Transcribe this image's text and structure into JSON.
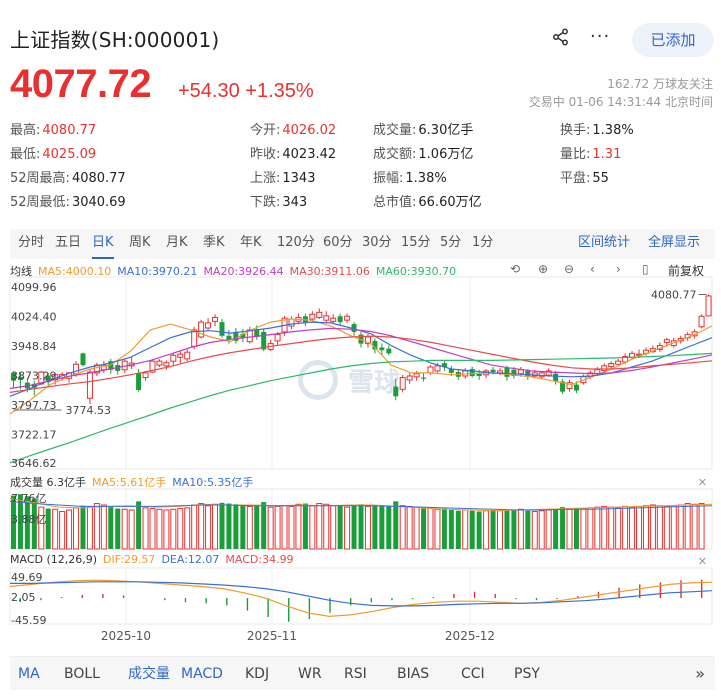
{
  "header": {
    "title": "上证指数(SH:000001)",
    "added_label": "已添加",
    "price": "4077.72",
    "change": "+54.30",
    "change_pct": "+1.35%",
    "followers": "162.72 万球友关注",
    "trade_time": "交易中 01-06 14:31:44 北京时间"
  },
  "stats": [
    {
      "label": "最高:",
      "value": "4080.77",
      "red": true
    },
    {
      "label": "今开:",
      "value": "4026.02",
      "red": true
    },
    {
      "label": "成交量:",
      "value": "6.30亿手",
      "red": false
    },
    {
      "label": "换手:",
      "value": "1.38%",
      "red": false
    },
    {
      "label": "最低:",
      "value": "4025.09",
      "red": true
    },
    {
      "label": "昨收:",
      "value": "4023.42",
      "red": false
    },
    {
      "label": "成交额:",
      "value": "1.06万亿",
      "red": false
    },
    {
      "label": "量比:",
      "value": "1.31",
      "red": true
    },
    {
      "label": "52周最高:",
      "value": "4080.77",
      "red": false
    },
    {
      "label": "上涨:",
      "value": "1343",
      "red": false
    },
    {
      "label": "振幅:",
      "value": "1.38%",
      "red": false
    },
    {
      "label": "平盘:",
      "value": "55",
      "red": false
    },
    {
      "label": "52周最低:",
      "value": "3040.69",
      "red": false
    },
    {
      "label": "下跌:",
      "value": "343",
      "red": false
    },
    {
      "label": "总市值:",
      "value": "66.60万亿",
      "red": false
    }
  ],
  "period_tabs": [
    "分时",
    "五日",
    "日K",
    "周K",
    "月K",
    "季K",
    "年K",
    "120分",
    "60分",
    "30分",
    "15分",
    "5分",
    "1分"
  ],
  "active_period": "日K",
  "tab_actions": {
    "range_stats": "区间统计",
    "fullscreen": "全屏显示"
  },
  "ma_legend": {
    "label": "均线",
    "items": [
      {
        "text": "MA5:4000.10",
        "color": "#f29a2e"
      },
      {
        "text": "MA10:3970.21",
        "color": "#3b6fd6"
      },
      {
        "text": "MA20:3926.44",
        "color": "#c23cc2"
      },
      {
        "text": "MA30:3911.06",
        "color": "#e84b4b"
      },
      {
        "text": "MA60:3930.70",
        "color": "#2fb86a"
      }
    ]
  },
  "adjust_label": "前复权",
  "vol_legend": {
    "label": "成交量 6.3亿手",
    "items": [
      {
        "text": "MA5:5.61亿手",
        "color": "#f29a2e"
      },
      {
        "text": "MA10:5.35亿手",
        "color": "#3b6fd6"
      }
    ]
  },
  "macd_legend": {
    "label": "MACD (12,26,9)",
    "items": [
      {
        "text": "DIF:29.57",
        "color": "#f29a2e"
      },
      {
        "text": "DEA:12.07",
        "color": "#3b6fd6"
      },
      {
        "text": "MACD:34.99",
        "color": "#e84b4b"
      }
    ]
  },
  "indicator_tabs": [
    "MA",
    "BOLL",
    "成交量",
    "MACD",
    "KDJ",
    "WR",
    "RSI",
    "BIAS",
    "CCI",
    "PSY"
  ],
  "active_indicators": [
    "MA",
    "成交量",
    "MACD"
  ],
  "colors": {
    "up": "#e93030",
    "down": "#1a9e3a",
    "accent": "#2f66c9"
  },
  "chart_data": {
    "type": "candlestick",
    "price_axis_labels": [
      "4099.96",
      "4024.40",
      "3948.84",
      "3873.29",
      "3797.73",
      "3722.17",
      "3646.62"
    ],
    "price_ylim": [
      3646.62,
      4099.96
    ],
    "high_marker": "4080.77",
    "low_marker": "3774.53",
    "x_labels": [
      "2025-10",
      "2025-11",
      "2025-12"
    ],
    "vol_axis_labels": [
      "7.76亿",
      "3.88亿"
    ],
    "vol_ylim": [
      0,
      7.76
    ],
    "macd_axis_labels": [
      "49.69",
      "2.05",
      "-45.59"
    ],
    "macd_ylim": [
      -45.59,
      49.69
    ],
    "candles": [
      [
        3880,
        3860,
        3883,
        3840,
        "d"
      ],
      [
        3870,
        3862,
        3880,
        3838,
        "d"
      ],
      [
        3855,
        3840,
        3866,
        3830,
        "d"
      ],
      [
        3852,
        3842,
        3860,
        3822,
        "d"
      ],
      [
        3852,
        3882,
        3885,
        3848,
        "u"
      ],
      [
        3873,
        3856,
        3880,
        3848,
        "d"
      ],
      [
        3862,
        3876,
        3880,
        3850,
        "u"
      ],
      [
        3866,
        3876,
        3882,
        3860,
        "u"
      ],
      [
        3866,
        3880,
        3882,
        3855,
        "u"
      ],
      [
        3878,
        3902,
        3910,
        3870,
        "u"
      ],
      [
        3930,
        3900,
        3932,
        3896,
        "d"
      ],
      [
        3815,
        3882,
        3890,
        3800,
        "u"
      ],
      [
        3880,
        3900,
        3906,
        3872,
        "u"
      ],
      [
        3888,
        3900,
        3910,
        3880,
        "u"
      ],
      [
        3910,
        3888,
        3916,
        3878,
        "d"
      ],
      [
        3900,
        3885,
        3912,
        3876,
        "d"
      ],
      [
        3888,
        3910,
        3916,
        3880,
        "u"
      ],
      [
        3898,
        3905,
        3922,
        3890,
        "u"
      ],
      [
        3880,
        3836,
        3890,
        3832,
        "d"
      ],
      [
        3868,
        3880,
        3885,
        3860,
        "u"
      ],
      [
        3882,
        3910,
        3912,
        3880,
        "u"
      ],
      [
        3900,
        3910,
        3915,
        3895,
        "u"
      ],
      [
        3898,
        3906,
        3912,
        3888,
        "u"
      ],
      [
        3910,
        3925,
        3930,
        3898,
        "u"
      ],
      [
        3920,
        3928,
        3935,
        3905,
        "u"
      ],
      [
        3916,
        3933,
        3940,
        3910,
        "u"
      ],
      [
        3948,
        3990,
        3998,
        3940,
        "u"
      ],
      [
        3972,
        4010,
        4016,
        3968,
        "u"
      ],
      [
        3995,
        4008,
        4020,
        3988,
        "u"
      ],
      [
        4012,
        4022,
        4030,
        4000,
        "u"
      ],
      [
        4010,
        3975,
        4018,
        3970,
        "d"
      ],
      [
        3975,
        3965,
        3990,
        3955,
        "d"
      ],
      [
        3985,
        3962,
        3995,
        3955,
        "d"
      ],
      [
        3980,
        3970,
        3992,
        3958,
        "d"
      ],
      [
        3960,
        3990,
        3998,
        3955,
        "u"
      ],
      [
        3992,
        3972,
        4002,
        3965,
        "d"
      ],
      [
        3985,
        3940,
        3992,
        3936,
        "d"
      ],
      [
        3940,
        3955,
        3965,
        3936,
        "u"
      ],
      [
        3962,
        3978,
        3985,
        3950,
        "u"
      ],
      [
        3985,
        4020,
        4026,
        3975,
        "u"
      ],
      [
        4000,
        4018,
        4025,
        3992,
        "u"
      ],
      [
        4012,
        4022,
        4032,
        4005,
        "u"
      ],
      [
        4025,
        4008,
        4032,
        4000,
        "d"
      ],
      [
        4018,
        4030,
        4038,
        4010,
        "u"
      ],
      [
        4022,
        4035,
        4045,
        4018,
        "u"
      ],
      [
        4015,
        4026,
        4038,
        4010,
        "u"
      ],
      [
        4012,
        4020,
        4030,
        4005,
        "u"
      ],
      [
        4025,
        4010,
        4032,
        4002,
        "d"
      ],
      [
        4015,
        4025,
        4032,
        4008,
        "u"
      ],
      [
        4005,
        3985,
        4010,
        3975,
        "d"
      ],
      [
        3978,
        3955,
        3985,
        3945,
        "d"
      ],
      [
        3955,
        3972,
        3980,
        3945,
        "u"
      ],
      [
        3962,
        3940,
        3968,
        3930,
        "d"
      ],
      [
        3945,
        3938,
        3955,
        3925,
        "d"
      ],
      [
        3942,
        3930,
        3950,
        3925,
        "d"
      ],
      [
        3845,
        3820,
        3865,
        3810,
        "d"
      ],
      [
        3838,
        3868,
        3875,
        3830,
        "u"
      ],
      [
        3862,
        3872,
        3880,
        3852,
        "u"
      ],
      [
        3870,
        3878,
        3885,
        3860,
        "u"
      ],
      [
        3868,
        3865,
        3880,
        3858,
        "d"
      ],
      [
        3880,
        3895,
        3900,
        3875,
        "u"
      ],
      [
        3885,
        3898,
        3905,
        3880,
        "u"
      ],
      [
        3905,
        3895,
        3912,
        3885,
        "d"
      ],
      [
        3890,
        3880,
        3898,
        3872,
        "d"
      ],
      [
        3882,
        3870,
        3890,
        3862,
        "d"
      ],
      [
        3872,
        3885,
        3892,
        3865,
        "u"
      ],
      [
        3890,
        3872,
        3896,
        3868,
        "d"
      ],
      [
        3878,
        3872,
        3888,
        3862,
        "d"
      ],
      [
        3875,
        3885,
        3890,
        3866,
        "u"
      ],
      [
        3888,
        3882,
        3895,
        3876,
        "d"
      ],
      [
        3880,
        3885,
        3892,
        3874,
        "u"
      ],
      [
        3893,
        3870,
        3898,
        3860,
        "d"
      ],
      [
        3888,
        3872,
        3895,
        3865,
        "d"
      ],
      [
        3878,
        3888,
        3895,
        3870,
        "u"
      ],
      [
        3885,
        3870,
        3890,
        3862,
        "d"
      ],
      [
        3872,
        3880,
        3888,
        3866,
        "u"
      ],
      [
        3870,
        3880,
        3885,
        3866,
        "u"
      ],
      [
        3874,
        3885,
        3892,
        3870,
        "u"
      ],
      [
        3878,
        3858,
        3885,
        3850,
        "d"
      ],
      [
        3858,
        3832,
        3865,
        3826,
        "d"
      ],
      [
        3840,
        3855,
        3862,
        3832,
        "u"
      ],
      [
        3850,
        3835,
        3858,
        3828,
        "d"
      ],
      [
        3855,
        3870,
        3876,
        3850,
        "u"
      ],
      [
        3870,
        3880,
        3886,
        3864,
        "u"
      ],
      [
        3878,
        3888,
        3895,
        3872,
        "u"
      ],
      [
        3886,
        3898,
        3904,
        3880,
        "u"
      ],
      [
        3896,
        3904,
        3910,
        3890,
        "u"
      ],
      [
        3902,
        3910,
        3916,
        3898,
        "u"
      ],
      [
        3908,
        3922,
        3930,
        3902,
        "u"
      ],
      [
        3920,
        3930,
        3936,
        3914,
        "u"
      ],
      [
        3925,
        3928,
        3940,
        3918,
        "u"
      ],
      [
        3930,
        3938,
        3945,
        3924,
        "u"
      ],
      [
        3935,
        3942,
        3950,
        3930,
        "u"
      ],
      [
        3940,
        3950,
        3958,
        3934,
        "u"
      ],
      [
        3958,
        3965,
        3970,
        3948,
        "u"
      ],
      [
        3950,
        3962,
        3970,
        3945,
        "u"
      ],
      [
        3962,
        3968,
        3975,
        3955,
        "u"
      ],
      [
        3970,
        3978,
        3985,
        3962,
        "u"
      ],
      [
        3975,
        3985,
        3992,
        3968,
        "u"
      ],
      [
        3998,
        4025,
        4030,
        3994,
        "u"
      ],
      [
        4026,
        4077,
        4081,
        4025,
        "u"
      ]
    ],
    "ma_series": [
      {
        "name": "MA5",
        "color": "#f29a2e",
        "values": [
          3775,
          3810,
          3850,
          3872,
          3890,
          3900,
          3935,
          3990,
          4005,
          3990,
          3972,
          3960,
          3990,
          4010,
          4018,
          4015,
          4000,
          3975,
          3955,
          3900,
          3880,
          3880,
          3875,
          3878,
          3880,
          3875,
          3870,
          3860,
          3850,
          3870,
          3890,
          3915,
          3935,
          3955,
          3975,
          4000
        ]
      },
      {
        "name": "MA10",
        "color": "#3b6fd6",
        "values": [
          3820,
          3840,
          3862,
          3880,
          3895,
          3905,
          3920,
          3945,
          3970,
          3985,
          3988,
          3982,
          3988,
          3995,
          4005,
          4010,
          4008,
          3995,
          3980,
          3950,
          3925,
          3905,
          3890,
          3885,
          3880,
          3878,
          3875,
          3872,
          3870,
          3872,
          3880,
          3895,
          3910,
          3930,
          3950,
          3970
        ]
      },
      {
        "name": "MA20",
        "color": "#c23cc2",
        "values": [
          3840,
          3848,
          3860,
          3872,
          3880,
          3890,
          3900,
          3912,
          3928,
          3945,
          3958,
          3966,
          3972,
          3978,
          3985,
          3990,
          3994,
          3992,
          3986,
          3975,
          3960,
          3945,
          3930,
          3915,
          3900,
          3892,
          3885,
          3882,
          3880,
          3878,
          3880,
          3886,
          3895,
          3905,
          3915,
          3926
        ]
      },
      {
        "name": "MA30",
        "color": "#e84b4b",
        "values": [
          3830,
          3838,
          3845,
          3852,
          3858,
          3866,
          3875,
          3885,
          3896,
          3910,
          3922,
          3932,
          3940,
          3948,
          3955,
          3962,
          3968,
          3972,
          3974,
          3972,
          3966,
          3958,
          3948,
          3938,
          3928,
          3918,
          3908,
          3900,
          3893,
          3890,
          3890,
          3893,
          3898,
          3902,
          3906,
          3911
        ]
      },
      {
        "name": "MA60",
        "color": "#2fb86a",
        "values": [
          3650,
          3668,
          3685,
          3702,
          3720,
          3738,
          3755,
          3772,
          3790,
          3806,
          3822,
          3836,
          3848,
          3860,
          3870,
          3880,
          3890,
          3898,
          3904,
          3908,
          3910,
          3912,
          3912,
          3912,
          3912,
          3913,
          3914,
          3915,
          3916,
          3917,
          3918,
          3920,
          3922,
          3924,
          3927,
          3930
        ]
      }
    ],
    "volumes": [
      7.4,
      7.6,
      7.3,
      7.0,
      5.8,
      5.6,
      5.5,
      5.2,
      5.4,
      5.7,
      6.0,
      5.9,
      6.3,
      6.1,
      5.8,
      5.6,
      5.5,
      5.4,
      6.6,
      5.7,
      5.6,
      5.5,
      5.4,
      5.5,
      5.6,
      5.7,
      6.1,
      6.3,
      6.0,
      6.2,
      6.4,
      6.3,
      6.2,
      6.0,
      5.9,
      6.1,
      6.5,
      5.8,
      5.9,
      6.0,
      5.9,
      6.2,
      6.3,
      6.0,
      6.3,
      6.2,
      6.0,
      6.1,
      5.8,
      6.0,
      6.2,
      5.9,
      6.1,
      6.0,
      5.9,
      6.6,
      6.0,
      5.9,
      5.8,
      5.6,
      5.7,
      5.5,
      5.6,
      5.4,
      5.3,
      5.4,
      5.3,
      5.2,
      5.3,
      5.4,
      5.3,
      5.3,
      5.4,
      5.5,
      5.3,
      5.2,
      5.3,
      5.4,
      5.6,
      5.8,
      5.5,
      5.7,
      5.6,
      5.7,
      5.8,
      5.9,
      5.8,
      5.7,
      5.9,
      5.8,
      5.9,
      6.0,
      6.1,
      6.0,
      5.9,
      6.0,
      6.1,
      6.3,
      6.2,
      6.3
    ],
    "vol_ma5": [
      7.0,
      6.4,
      5.8,
      5.7,
      5.9,
      6.0,
      5.8,
      5.9,
      6.2,
      6.1,
      6.1,
      6.0,
      6.1,
      6.0,
      6.1,
      6.1,
      5.9,
      5.7,
      5.5,
      5.4,
      5.3,
      5.4,
      5.5,
      5.6,
      5.7,
      5.8,
      5.9,
      6.0,
      6.1,
      6.2
    ],
    "vol_ma10": [
      6.6,
      6.3,
      6.1,
      5.9,
      5.9,
      5.9,
      5.9,
      6.0,
      6.1,
      6.1,
      6.0,
      6.0,
      6.0,
      6.0,
      6.0,
      6.0,
      5.9,
      5.8,
      5.7,
      5.6,
      5.5,
      5.4,
      5.4,
      5.5,
      5.5,
      5.6,
      5.7,
      5.8,
      5.9,
      6.0
    ],
    "dif": [
      22,
      26,
      30,
      33,
      34,
      33,
      31,
      28,
      25,
      22,
      18,
      10,
      0,
      -15,
      -28,
      -35,
      -32,
      -26,
      -18,
      -12,
      -8,
      -6,
      -6,
      -8,
      -10,
      -8,
      -4,
      2,
      8,
      14,
      20,
      26,
      29,
      30
    ],
    "dea": [
      28,
      28,
      29,
      30,
      31,
      31,
      31,
      30,
      29,
      27,
      25,
      22,
      18,
      12,
      4,
      -4,
      -10,
      -14,
      -15,
      -15,
      -14,
      -12,
      -11,
      -10,
      -10,
      -9,
      -7,
      -5,
      -2,
      2,
      6,
      10,
      12,
      14
    ],
    "macd_bars": [
      -8,
      -4,
      2,
      6,
      8,
      5,
      0,
      -4,
      -8,
      -10,
      -14,
      -24,
      -36,
      -45,
      -40,
      -28,
      -14,
      -8,
      -4,
      -2,
      2,
      8,
      12,
      8,
      -2,
      -4,
      -2,
      4,
      12,
      20,
      26,
      30,
      34,
      35
    ]
  }
}
